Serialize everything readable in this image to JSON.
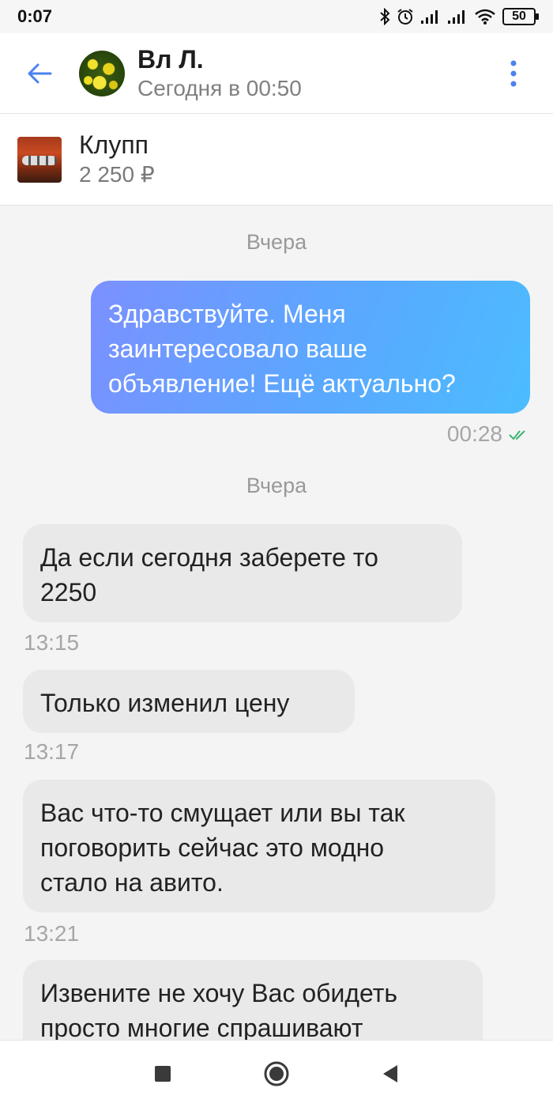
{
  "status_bar": {
    "time": "0:07",
    "battery": "50",
    "icons": [
      "bluetooth-icon",
      "alarm-icon",
      "signal-icon",
      "signal-icon",
      "wifi-icon",
      "battery-icon"
    ]
  },
  "header": {
    "peer_name": "Вл Л.",
    "peer_status": "Сегодня в 00:50",
    "back_icon": "arrow-left-icon",
    "menu_icon": "more-vertical-icon",
    "accent": "#4b82f0"
  },
  "listing": {
    "title": "Клупп",
    "price": "2 250 ₽"
  },
  "chat": {
    "messages": [
      {
        "type": "date",
        "text": "Вчера"
      },
      {
        "type": "out",
        "lines": [
          "Здравствуйте. Меня",
          "заинтересовало ваше",
          "объявление! Ещё актуально?"
        ],
        "time": "00:28",
        "status": "read"
      },
      {
        "type": "date",
        "text": "Вчера"
      },
      {
        "type": "in",
        "lines": [
          "Да если сегодня заберете то",
          "2250"
        ],
        "time": "13:15"
      },
      {
        "type": "in",
        "lines": [
          "Только изменил цену"
        ],
        "time": "13:17"
      },
      {
        "type": "in",
        "lines": [
          "Вас что-то смущает или вы так",
          "поговорить сейчас это модно",
          "стало на авито."
        ],
        "time": "13:21"
      },
      {
        "type": "in",
        "lines": [
          "Извените не хочу Вас обидеть",
          "просто многие спрашивают"
        ],
        "time": ""
      }
    ]
  },
  "colors": {
    "outgoing_bubble_start": "#7b90ff",
    "outgoing_bubble_end": "#4cbcff",
    "incoming_bubble": "#e9e9e9",
    "read_check": "#3cb371"
  },
  "navbar": {
    "buttons": [
      "recent-apps-icon",
      "home-icon",
      "back-triangle-icon"
    ]
  }
}
